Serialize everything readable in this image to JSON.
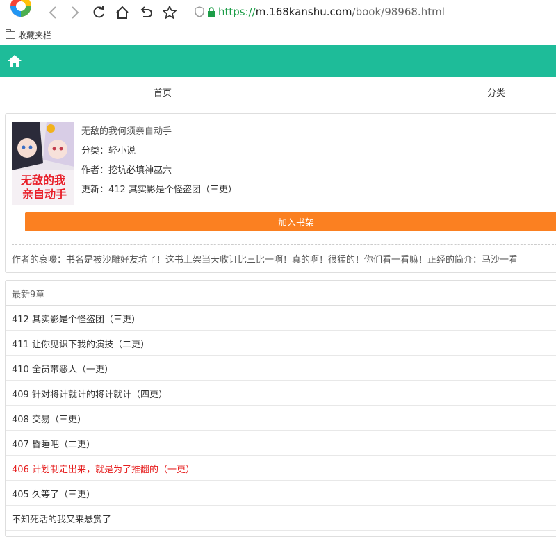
{
  "browser": {
    "url_scheme": "https://",
    "url_host": "m.168kanshu.com",
    "url_path": "/book/98968.html",
    "bookmark_folder": "收藏夹栏"
  },
  "site": {
    "accent": "#1ebc99",
    "nav": {
      "home": "首页",
      "category": "分类"
    }
  },
  "book": {
    "title": "无敌的我何须亲自动手",
    "category_label": "分类：",
    "category": "轻小说",
    "author_label": "作者：",
    "author": "挖坑必填神巫六",
    "update_label": "更新：",
    "update": "412 其实影是个怪盗团（三更）",
    "shelf_button": "加入书架",
    "intro": "作者的哀嚎：书名是被沙雕好友坑了！这书上架当天收订比三比一啊！真的啊！很猛的！你们看一看嘛！正经的简介：马沙一看",
    "cover_title_lines": [
      "无敌的我",
      "亲自动手"
    ]
  },
  "latest": {
    "heading": "最新9章",
    "items": [
      {
        "title": "412 其实影是个怪盗团（三更）"
      },
      {
        "title": "411 让你见识下我的演技（二更）"
      },
      {
        "title": "410 全员带恶人（一更）"
      },
      {
        "title": "409 针对将计就计的将计就计（四更）"
      },
      {
        "title": "408 交易（三更）"
      },
      {
        "title": "407 昏睡吧（二更）"
      },
      {
        "title": "406 计划制定出来，就是为了推翻的（一更）",
        "highlight": true
      },
      {
        "title": "405 久等了（三更）"
      },
      {
        "title": "不知死活的我又来悬赏了"
      }
    ]
  }
}
